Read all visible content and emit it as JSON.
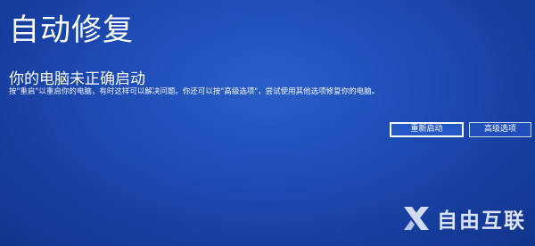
{
  "screen": {
    "title": "自动修复",
    "heading": "你的电脑未正确启动",
    "message": "按\"重启\"以重启你的电脑，有时这样可以解决问题。你还可以按\"高级选项\"，尝试使用其他选项修复你的电脑。"
  },
  "buttons": {
    "restart_label": "重新启动",
    "advanced_label": "高级选项"
  },
  "watermark": {
    "text": "自由互联",
    "logo_icon": "x-logo-icon"
  },
  "colors": {
    "background": "#1d4ab3",
    "text": "#ffffff",
    "button_border": "#ffffff"
  }
}
